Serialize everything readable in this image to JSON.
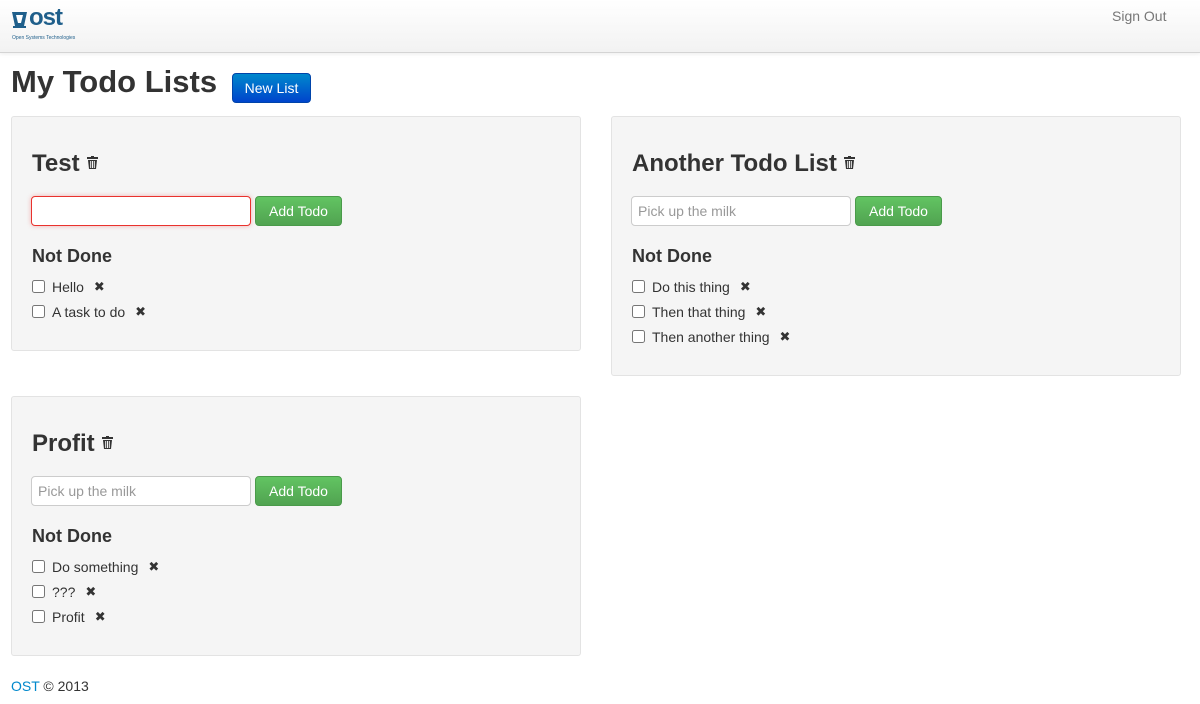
{
  "navbar": {
    "brand": "ost",
    "brand_tagline": "Open Systems Technologies",
    "sign_out": "Sign Out"
  },
  "page": {
    "title": "My Todo Lists",
    "new_list_button": "New List"
  },
  "lists": [
    {
      "title": "Test",
      "input_value": "",
      "input_placeholder": "",
      "add_button": "Add Todo",
      "section_title": "Not Done",
      "items": [
        "Hello",
        "A task to do"
      ]
    },
    {
      "title": "Another Todo List",
      "input_value": "",
      "input_placeholder": "Pick up the milk",
      "add_button": "Add Todo",
      "section_title": "Not Done",
      "items": [
        "Do this thing",
        "Then that thing",
        "Then another thing"
      ]
    },
    {
      "title": "Profit",
      "input_value": "",
      "input_placeholder": "Pick up the milk",
      "add_button": "Add Todo",
      "section_title": "Not Done",
      "items": [
        "Do something",
        "???",
        "Profit"
      ]
    }
  ],
  "icons": {
    "delete_list": "trash-icon",
    "remove_item": "close-icon",
    "remove_glyph": "✖"
  },
  "footer": {
    "link": "OST",
    "text": "© 2013"
  },
  "colors": {
    "primary": "#0055cc",
    "success": "#5bb75b",
    "link": "#0088cc",
    "error_focus": "#e9322d"
  }
}
